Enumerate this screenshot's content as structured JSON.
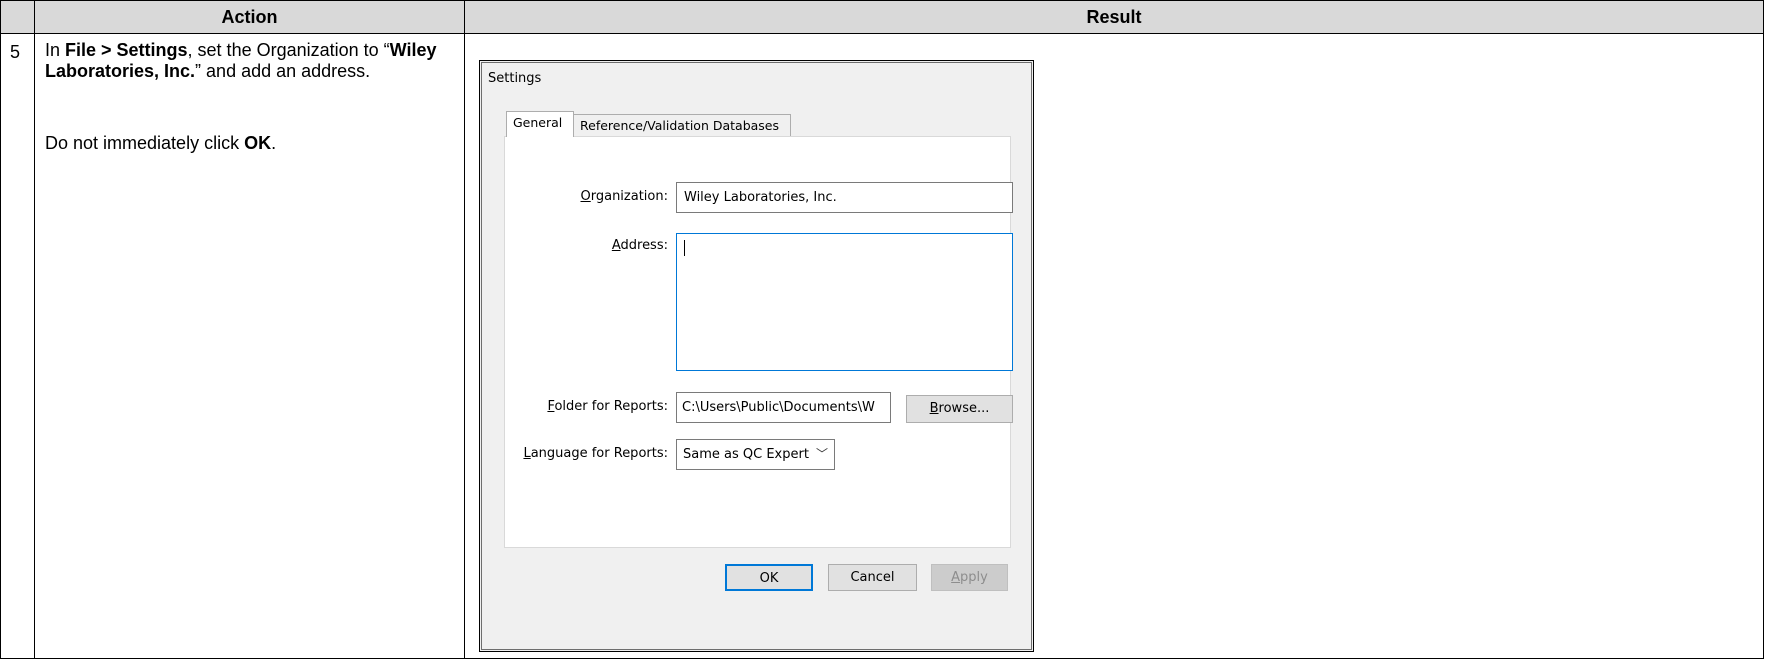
{
  "table": {
    "header_action": "Action",
    "header_result": "Result",
    "step_number": "5",
    "action_p1": [
      "In ",
      "File > Settings",
      ", set the Organization to “",
      "Wiley Laboratories, Inc.",
      "” and add an address."
    ],
    "action_p2": [
      "Do not immediately click ",
      "OK",
      "."
    ]
  },
  "dialog": {
    "title": "Settings",
    "tabs": [
      {
        "label": "General",
        "selected": true
      },
      {
        "label": "Reference/Validation Databases",
        "selected": false
      }
    ],
    "organization_label": {
      "mnemonic": "O",
      "rest": "rganization:"
    },
    "organization_value": "Wiley Laboratories, Inc.",
    "address_label": {
      "mnemonic": "A",
      "rest": "ddress:"
    },
    "address_value": "",
    "folder_label": {
      "mnemonic": "F",
      "rest": "older for Reports:"
    },
    "folder_value": "C:\\Users\\Public\\Documents\\W",
    "browse_button": {
      "mnemonic": "B",
      "rest": "rowse..."
    },
    "language_label": {
      "mnemonic": "L",
      "rest": "anguage for Reports:"
    },
    "language_value": "Same as QC Expert",
    "ok_button": "OK",
    "cancel_button": "Cancel",
    "apply_button": {
      "mnemonic": "A",
      "rest": "pply"
    },
    "colors": {
      "focus_blue": "#0078d7",
      "dialog_bg": "#f0f0f0",
      "header_gray": "#d9d9d9"
    },
    "icons": {
      "dropdown": "chevron-down-icon"
    }
  }
}
